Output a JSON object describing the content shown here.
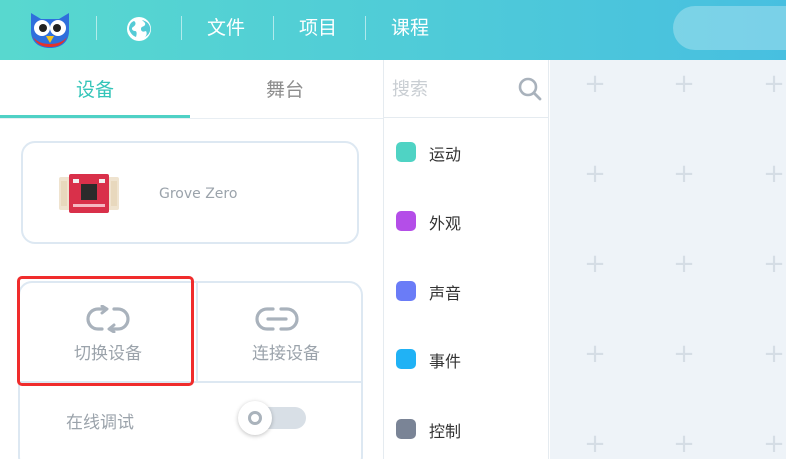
{
  "topbar": {
    "menu": [
      "文件",
      "项目",
      "课程"
    ]
  },
  "tabs": [
    "设备",
    "舞台"
  ],
  "device": {
    "name": "Grove Zero"
  },
  "actions": {
    "switch_label": "切换设备",
    "connect_label": "连接设备",
    "debug_label": "在线调试",
    "debug_enabled": false
  },
  "search": {
    "placeholder": "搜索"
  },
  "categories": [
    {
      "label": "运动",
      "color": "#4fd3c4"
    },
    {
      "label": "外观",
      "color": "#b44ee8"
    },
    {
      "label": "声音",
      "color": "#6a7cf7"
    },
    {
      "label": "事件",
      "color": "#20b2f5"
    },
    {
      "label": "控制",
      "color": "#7a8496"
    }
  ],
  "colors": {
    "accent": "#35c5b9",
    "highlight": "#f02c2c"
  }
}
